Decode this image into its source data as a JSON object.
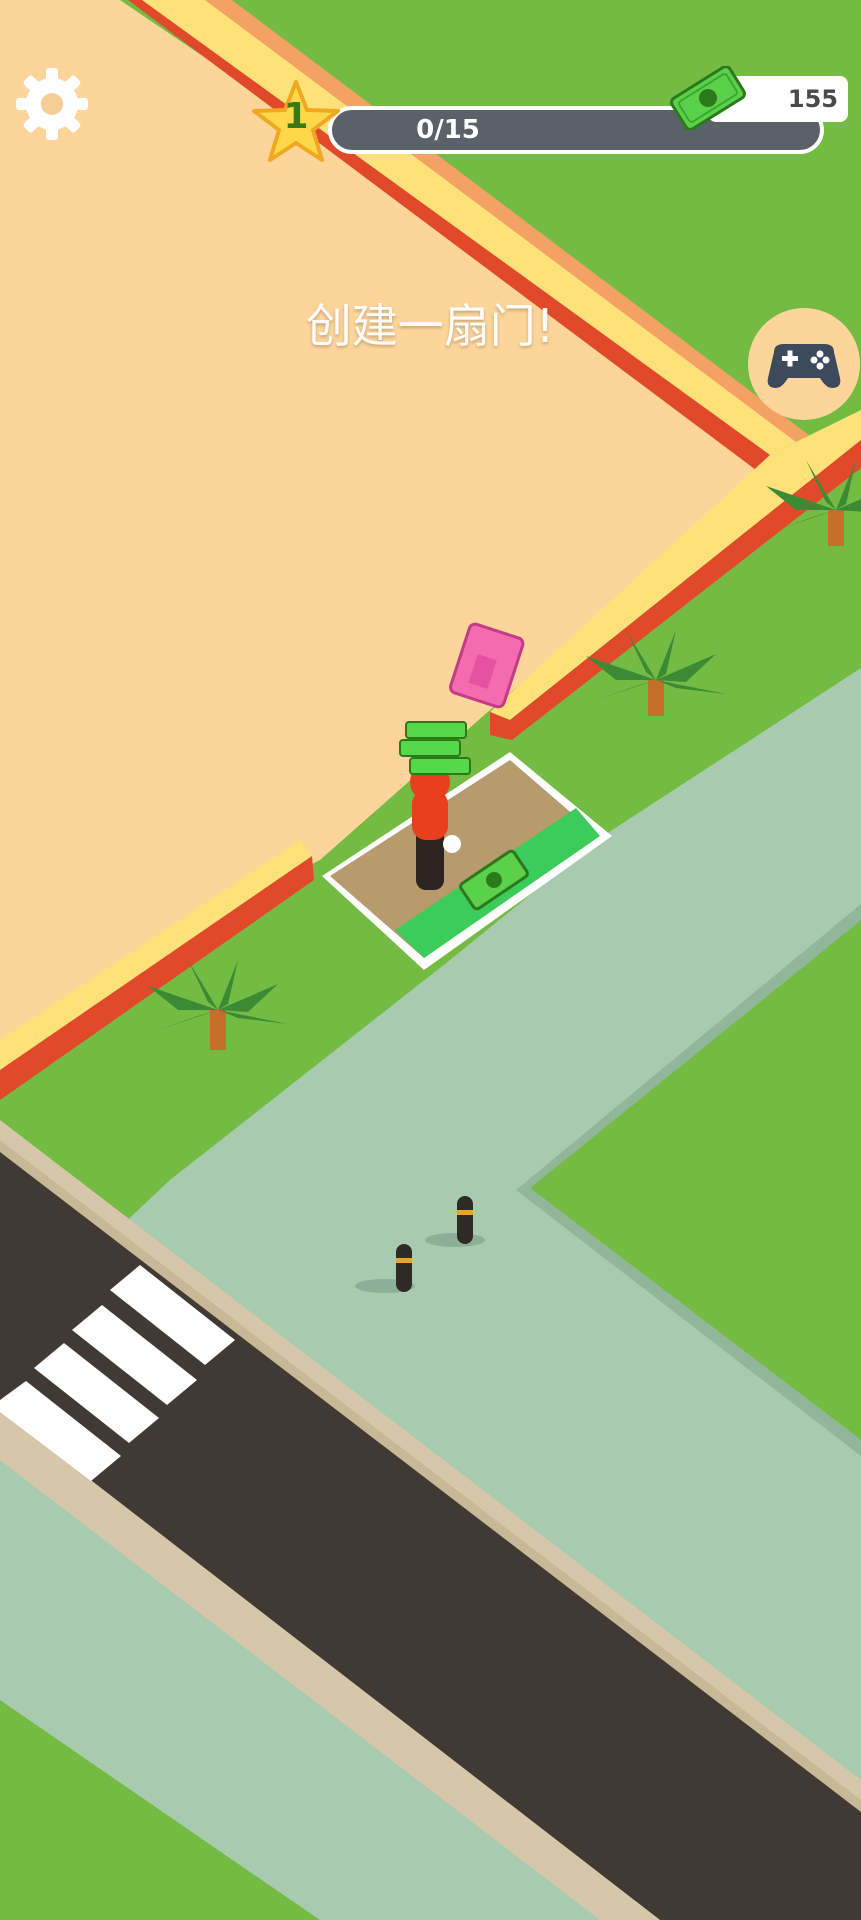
{
  "hud": {
    "level": "1",
    "progress_text": "0/15",
    "progress": 0,
    "money": "155",
    "task": "创建一扇门!"
  },
  "icons": {
    "settings": "gear-icon",
    "level_badge": "star-icon",
    "currency": "cash-icon",
    "minigames": "gamepad-icon",
    "hint": "door-marker-icon"
  },
  "colors": {
    "grass": "#74bb44",
    "floor": "#fdd59a",
    "wall_top": "#ffe17a",
    "wall_side": "#e04a2a",
    "sidewalk": "#a8cbb0",
    "road": "#413a34",
    "curb": "#d6c7aa",
    "build_zone": "#3ccc5a",
    "star": "#ffd84a"
  }
}
